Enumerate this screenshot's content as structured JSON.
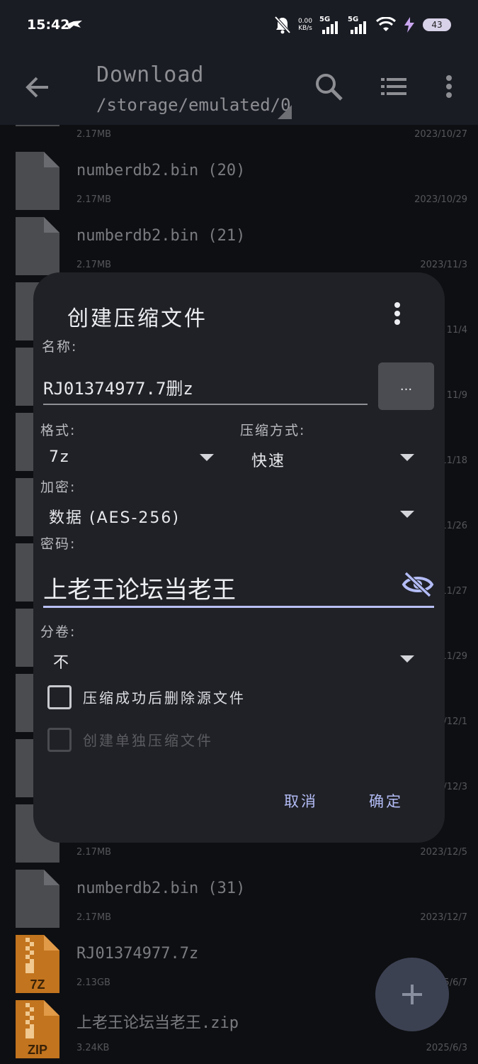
{
  "status_bar": {
    "time": "15:42",
    "net_speed_value": "0.00",
    "net_speed_unit": "KB/s",
    "sim1": "5G",
    "sim2": "5G",
    "battery": "43"
  },
  "app_bar": {
    "title": "Download",
    "path": "/storage/emulated/0"
  },
  "files": [
    {
      "name": "",
      "size": "2.17MB",
      "date": "2023/10/27",
      "icon": "file-icon"
    },
    {
      "name": "numberdb2.bin (20)",
      "size": "2.17MB",
      "date": "2023/10/29",
      "icon": "file-icon"
    },
    {
      "name": "numberdb2.bin (21)",
      "size": "2.17MB",
      "date": "2023/11/3",
      "icon": "file-icon"
    },
    {
      "name": "",
      "size": "",
      "date": "11/4",
      "icon": "file-icon"
    },
    {
      "name": "",
      "size": "",
      "date": "11/9",
      "icon": "file-icon"
    },
    {
      "name": "",
      "size": "",
      "date": "11/18",
      "icon": "file-icon"
    },
    {
      "name": "",
      "size": "",
      "date": "11/26",
      "icon": "file-icon"
    },
    {
      "name": "",
      "size": "",
      "date": "11/27",
      "icon": "file-icon"
    },
    {
      "name": "",
      "size": "",
      "date": "11/29",
      "icon": "file-icon"
    },
    {
      "name": "",
      "size": "",
      "date": "/12/1",
      "icon": "file-icon"
    },
    {
      "name": "",
      "size": "",
      "date": "/12/3",
      "icon": "file-icon"
    },
    {
      "name": "",
      "size": "2.17MB",
      "date": "2023/12/5",
      "icon": "file-icon"
    },
    {
      "name": "numberdb2.bin (31)",
      "size": "2.17MB",
      "date": "2023/12/7",
      "icon": "file-icon"
    },
    {
      "name": "RJ01374977.7z",
      "size": "2.13GB",
      "date": "5/6/7",
      "icon": "archive-7z-icon",
      "badge": "7Z"
    },
    {
      "name": "上老王论坛当老王.zip",
      "size": "3.24KB",
      "date": "2025/6/3",
      "icon": "archive-zip-icon",
      "badge": "ZIP"
    }
  ],
  "dialog": {
    "title": "创建压缩文件",
    "name_label": "名称:",
    "name_value": "RJ01374977.7删z",
    "more_button": "...",
    "format_label": "格式:",
    "format_value": "7z",
    "method_label": "压缩方式:",
    "method_value": "快速",
    "encryption_label": "加密:",
    "encryption_value": "数据 (AES-256)",
    "password_label": "密码:",
    "password_value": "上老王论坛当老王",
    "split_label": "分卷:",
    "split_value": "不",
    "delete_source_label": "压缩成功后删除源文件",
    "separate_archive_label": "创建单独压缩文件",
    "cancel_label": "取消",
    "ok_label": "确定"
  },
  "colors": {
    "accent": "#b3bcf6",
    "dialog_bg": "#202126",
    "app_bar_bg": "#1a1c24",
    "archive_orange": "#c2741e"
  }
}
